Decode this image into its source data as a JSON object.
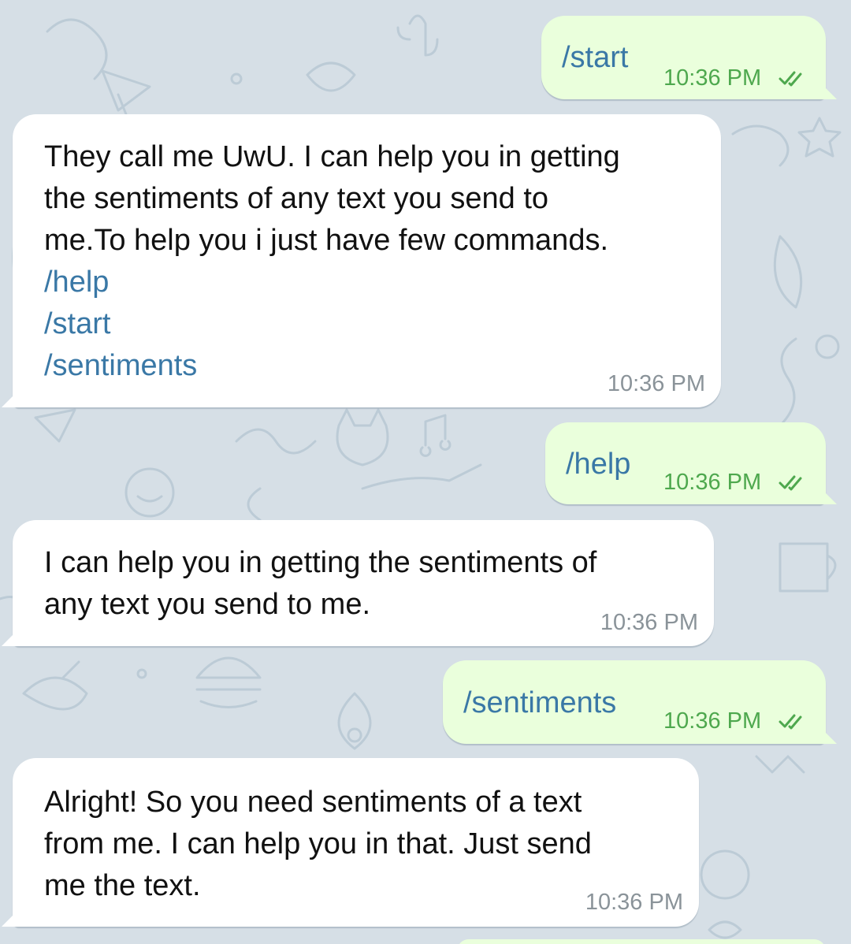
{
  "theme": {
    "wallpaper": "#d6dfe6",
    "outgoing_bubble": "#eaffdc",
    "incoming_bubble": "#ffffff",
    "link_color": "#3a78a6",
    "outgoing_time_color": "#4ea84e",
    "incoming_time_color": "#8a9399"
  },
  "messages": [
    {
      "direction": "outgoing",
      "text": "/start",
      "time": "10:36 PM",
      "status_icon": "double-check-icon"
    },
    {
      "direction": "incoming",
      "lines": [
        "They call me UwU. I can help you in getting",
        "the sentiments of any text you send to",
        "me.To help you i just have few commands."
      ],
      "links": [
        "/help",
        "/start",
        "/sentiments"
      ],
      "time": "10:36 PM"
    },
    {
      "direction": "outgoing",
      "text": "/help",
      "time": "10:36 PM",
      "status_icon": "double-check-icon"
    },
    {
      "direction": "incoming",
      "lines": [
        "I can help you in getting the sentiments of",
        "any text you send to me."
      ],
      "time": "10:36 PM"
    },
    {
      "direction": "outgoing",
      "text": "/sentiments",
      "time": "10:36 PM",
      "status_icon": "double-check-icon"
    },
    {
      "direction": "incoming",
      "lines": [
        "Alright! So you need sentiments of a text",
        "from me. I can help you in that. Just send",
        "me the text."
      ],
      "time": "10:36 PM"
    }
  ]
}
